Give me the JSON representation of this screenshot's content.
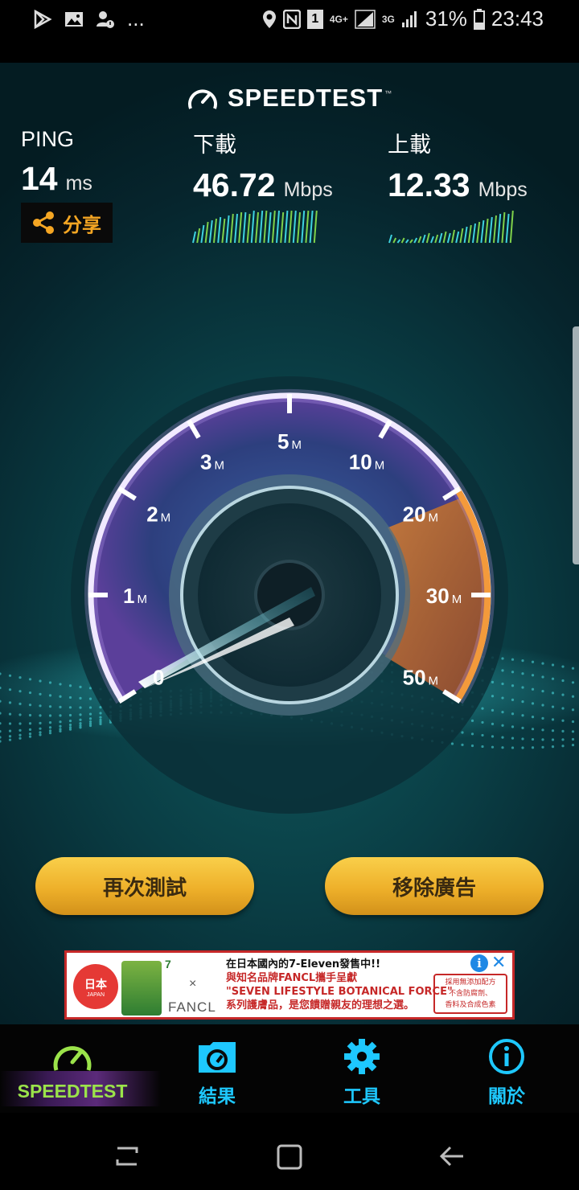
{
  "status_bar": {
    "left_dots": "...",
    "network_4g": "4G+",
    "network_3g": "3G",
    "sim_number": "1",
    "battery": "31%",
    "time": "23:43"
  },
  "header": {
    "brand": "SPEEDTEST",
    "trademark": "™"
  },
  "metrics": {
    "ping": {
      "label": "PING",
      "value": "14",
      "unit": "ms"
    },
    "download": {
      "label": "下載",
      "value": "46.72",
      "unit": "Mbps"
    },
    "upload": {
      "label": "上載",
      "value": "12.33",
      "unit": "Mbps"
    }
  },
  "share": {
    "label": "分享"
  },
  "gauge": {
    "ticks": [
      {
        "label": "0",
        "unit": ""
      },
      {
        "label": "1",
        "unit": "M"
      },
      {
        "label": "2",
        "unit": "M"
      },
      {
        "label": "3",
        "unit": "M"
      },
      {
        "label": "5",
        "unit": "M"
      },
      {
        "label": "10",
        "unit": "M"
      },
      {
        "label": "20",
        "unit": "M"
      },
      {
        "label": "30",
        "unit": "M"
      },
      {
        "label": "50",
        "unit": "M"
      }
    ],
    "needle_value": "0"
  },
  "buttons": {
    "test_again": "再次測試",
    "remove_ads": "移除廣告"
  },
  "ad": {
    "logo_text": "日本",
    "logo_sub": "JAPAN",
    "brand_711": "7",
    "cross": "×",
    "fancl": "FANCL",
    "line1": "在日本國內的7-Eleven發售中!!",
    "line2": "與知名品牌FANCL攜手呈獻",
    "line3": "\"SEVEN LIFESTYLE BOTANICAL FORCE\"",
    "line4": "系列護膚品，是您饋贈親友的理想之選。",
    "box_lines": [
      "採用無添加配方",
      "不含防腐劑、",
      "香料及合成色素"
    ],
    "info": "i",
    "close": "✕"
  },
  "tabs": [
    {
      "label": "SPEEDTEST",
      "icon": "speedometer-icon",
      "color": "#9be34a",
      "active": true
    },
    {
      "label": "結果",
      "icon": "results-folder-icon",
      "color": "#1ec8ff",
      "active": false
    },
    {
      "label": "工具",
      "icon": "gear-icon",
      "color": "#1ec8ff",
      "active": false
    },
    {
      "label": "關於",
      "icon": "info-icon",
      "color": "#1ec8ff",
      "active": false
    }
  ],
  "colors": {
    "accent_green": "#9be34a",
    "accent_cyan": "#1ec8ff",
    "button_gold": "#eeb02a",
    "share_orange": "#f5a623"
  }
}
